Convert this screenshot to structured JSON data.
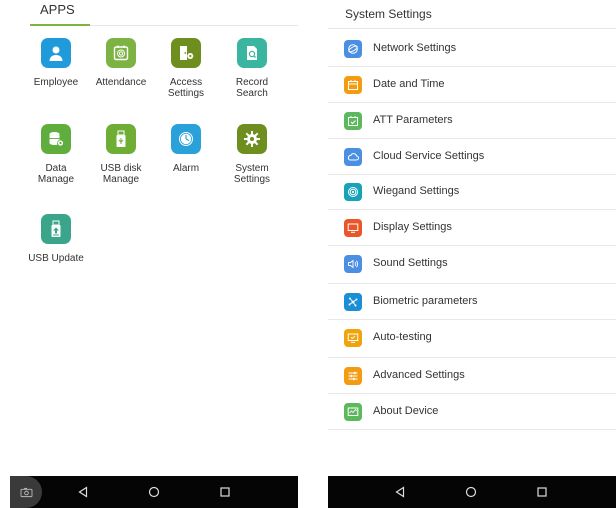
{
  "apps_screen": {
    "header": "APPS",
    "apps": [
      {
        "name": "employee",
        "label": "Employee",
        "color": "#1e9bd8",
        "icon": "person-icon"
      },
      {
        "name": "attendance",
        "label": "Attendance",
        "color": "#7cb342",
        "icon": "fingerprint-icon"
      },
      {
        "name": "access-settings",
        "label": "Access\nSettings",
        "color": "#6e8f1f",
        "icon": "door-gear-icon"
      },
      {
        "name": "record-search",
        "label": "Record\nSearch",
        "color": "#3ab5a0",
        "icon": "doc-search-icon"
      },
      {
        "name": "data-manage",
        "label": "Data\nManage",
        "color": "#5fae3d",
        "icon": "database-gear-icon"
      },
      {
        "name": "usb-disk-manage",
        "label": "USB disk\nManage",
        "color": "#6fae34",
        "icon": "usb-drive-icon"
      },
      {
        "name": "alarm",
        "label": "Alarm",
        "color": "#2aa2d9",
        "icon": "clock-icon"
      },
      {
        "name": "system-settings",
        "label": "System\nSettings",
        "color": "#6e8f1f",
        "icon": "gear-icon"
      },
      {
        "name": "usb-update",
        "label": "USB Update",
        "color": "#3aa58b",
        "icon": "usb-update-icon"
      }
    ]
  },
  "settings_screen": {
    "title": "System Settings",
    "items": [
      {
        "name": "network-settings",
        "label": "Network Settings",
        "color": "#4a8fe2",
        "icon": "network-icon"
      },
      {
        "name": "date-and-time",
        "label": "Date and Time",
        "color": "#f39c12",
        "icon": "calendar-icon"
      },
      {
        "name": "att-parameters",
        "label": "ATT Parameters",
        "color": "#5cb85c",
        "icon": "calendar-check-icon"
      },
      {
        "name": "cloud-service-settings",
        "label": "Cloud Service Settings",
        "color": "#4a8fe2",
        "icon": "cloud-icon"
      },
      {
        "name": "wiegand-settings",
        "label": "Wiegand Settings",
        "color": "#17a2b8",
        "icon": "target-icon"
      },
      {
        "name": "display-settings",
        "label": "Display Settings",
        "color": "#e8562a",
        "icon": "monitor-icon"
      },
      {
        "name": "sound-settings",
        "label": "Sound Settings",
        "color": "#4a8fe2",
        "icon": "speaker-icon"
      },
      {
        "name": "biometric-parameters",
        "label": "Biometric parameters",
        "color": "#1a8fd6",
        "icon": "biometric-nodes-icon"
      },
      {
        "name": "auto-testing",
        "label": "Auto-testing",
        "color": "#f0a30a",
        "icon": "monitor-check-icon"
      },
      {
        "name": "advanced-settings",
        "label": "Advanced Settings",
        "color": "#f39c12",
        "icon": "sliders-icon"
      },
      {
        "name": "about-device",
        "label": "About Device",
        "color": "#5cb85c",
        "icon": "device-info-icon"
      }
    ]
  },
  "nav": {
    "back_icon": "back-triangle-icon",
    "home_icon": "home-circle-icon",
    "recent_icon": "recent-square-icon",
    "camera_icon": "camera-icon"
  }
}
